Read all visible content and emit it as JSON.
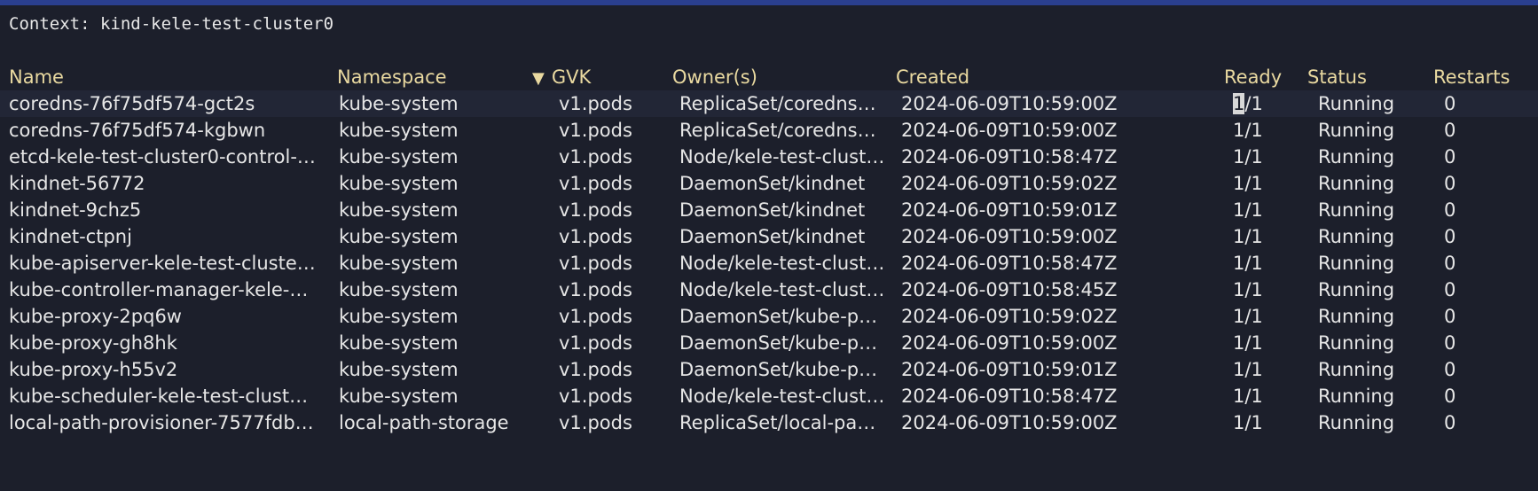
{
  "context": "Context: kind-kele-test-cluster0",
  "headers": {
    "name": "Name",
    "namespace": "Namespace",
    "gvk": "GVK",
    "owner": "Owner(s)",
    "created": "Created",
    "ready": "Ready",
    "status": "Status",
    "restarts": "Restarts"
  },
  "sort_icon": "▼",
  "rows": [
    {
      "name": "coredns-76f75df574-gct2s",
      "namespace": "kube-system",
      "gvk": "v1.pods",
      "owner": "ReplicaSet/coredns…",
      "created": "2024-06-09T10:59:00Z",
      "ready_a": "1",
      "ready_b": "/1",
      "status": "Running",
      "restarts": "0"
    },
    {
      "name": "coredns-76f75df574-kgbwn",
      "namespace": "kube-system",
      "gvk": "v1.pods",
      "owner": "ReplicaSet/coredns…",
      "created": "2024-06-09T10:59:00Z",
      "ready": "1/1",
      "status": "Running",
      "restarts": "0"
    },
    {
      "name": "etcd-kele-test-cluster0-control-…",
      "namespace": "kube-system",
      "gvk": "v1.pods",
      "owner": "Node/kele-test-clust…",
      "created": "2024-06-09T10:58:47Z",
      "ready": "1/1",
      "status": "Running",
      "restarts": "0"
    },
    {
      "name": "kindnet-56772",
      "namespace": "kube-system",
      "gvk": "v1.pods",
      "owner": "DaemonSet/kindnet",
      "created": "2024-06-09T10:59:02Z",
      "ready": "1/1",
      "status": "Running",
      "restarts": "0"
    },
    {
      "name": "kindnet-9chz5",
      "namespace": "kube-system",
      "gvk": "v1.pods",
      "owner": "DaemonSet/kindnet",
      "created": "2024-06-09T10:59:01Z",
      "ready": "1/1",
      "status": "Running",
      "restarts": "0"
    },
    {
      "name": "kindnet-ctpnj",
      "namespace": "kube-system",
      "gvk": "v1.pods",
      "owner": "DaemonSet/kindnet",
      "created": "2024-06-09T10:59:00Z",
      "ready": "1/1",
      "status": "Running",
      "restarts": "0"
    },
    {
      "name": "kube-apiserver-kele-test-cluste…",
      "namespace": "kube-system",
      "gvk": "v1.pods",
      "owner": "Node/kele-test-clust…",
      "created": "2024-06-09T10:58:47Z",
      "ready": "1/1",
      "status": "Running",
      "restarts": "0"
    },
    {
      "name": "kube-controller-manager-kele-…",
      "namespace": "kube-system",
      "gvk": "v1.pods",
      "owner": "Node/kele-test-clust…",
      "created": "2024-06-09T10:58:45Z",
      "ready": "1/1",
      "status": "Running",
      "restarts": "0"
    },
    {
      "name": "kube-proxy-2pq6w",
      "namespace": "kube-system",
      "gvk": "v1.pods",
      "owner": "DaemonSet/kube-p…",
      "created": "2024-06-09T10:59:02Z",
      "ready": "1/1",
      "status": "Running",
      "restarts": "0"
    },
    {
      "name": "kube-proxy-gh8hk",
      "namespace": "kube-system",
      "gvk": "v1.pods",
      "owner": "DaemonSet/kube-p…",
      "created": "2024-06-09T10:59:00Z",
      "ready": "1/1",
      "status": "Running",
      "restarts": "0"
    },
    {
      "name": "kube-proxy-h55v2",
      "namespace": "kube-system",
      "gvk": "v1.pods",
      "owner": "DaemonSet/kube-p…",
      "created": "2024-06-09T10:59:01Z",
      "ready": "1/1",
      "status": "Running",
      "restarts": "0"
    },
    {
      "name": "kube-scheduler-kele-test-clust…",
      "namespace": "kube-system",
      "gvk": "v1.pods",
      "owner": "Node/kele-test-clust…",
      "created": "2024-06-09T10:58:47Z",
      "ready": "1/1",
      "status": "Running",
      "restarts": "0"
    },
    {
      "name": "local-path-provisioner-7577fdb…",
      "namespace": "local-path-storage",
      "gvk": "v1.pods",
      "owner": "ReplicaSet/local-pa…",
      "created": "2024-06-09T10:59:00Z",
      "ready": "1/1",
      "status": "Running",
      "restarts": "0"
    }
  ],
  "colors": {
    "background": "#1c1f2b",
    "header_text": "#e9d9a0",
    "row_text": "#e6e6e6",
    "top_bar": "#2a3f8f"
  }
}
